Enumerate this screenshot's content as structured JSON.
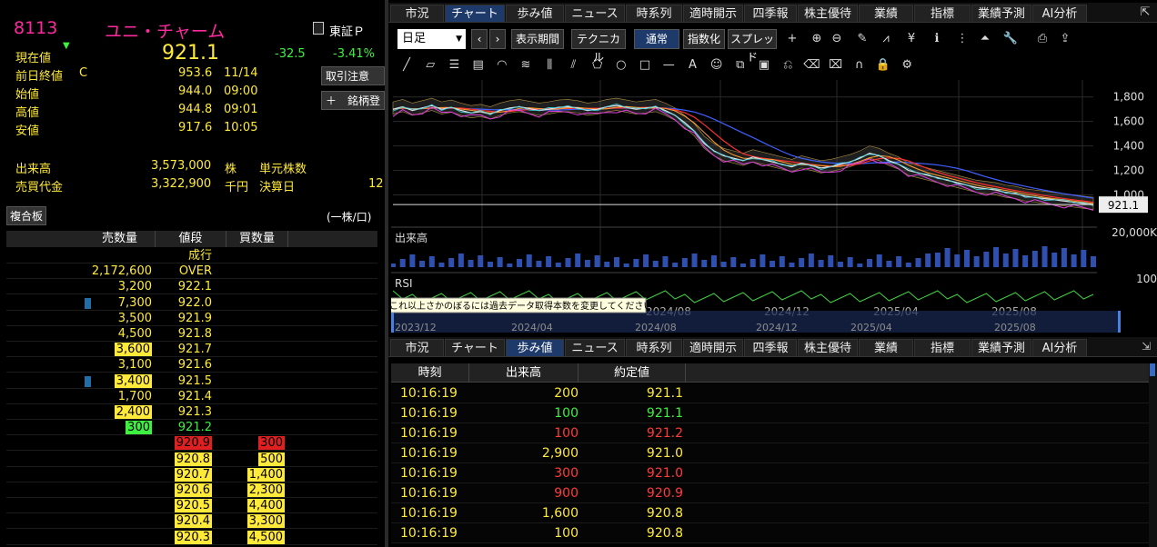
{
  "quote": {
    "code": "8113",
    "name": "ユニ・チャーム",
    "market": "東証Ｐ",
    "price_label": "現在値",
    "price": "921.1",
    "change": "-32.5",
    "change_pct": "-3.41%",
    "rows": [
      {
        "label": "前日終値",
        "flag": "C",
        "value": "953.6",
        "time": "11/14"
      },
      {
        "label": "始値",
        "flag": "",
        "value": "944.0",
        "time": "09:00"
      },
      {
        "label": "高値",
        "flag": "",
        "value": "944.8",
        "time": "09:01"
      },
      {
        "label": "安値",
        "flag": "",
        "value": "917.6",
        "time": "10:05"
      }
    ],
    "volume_label": "出来高",
    "volume": "3,573,000",
    "volume_unit": "株",
    "value_label": "売買代金",
    "value": "3,322,900",
    "value_unit": "千円",
    "unit_label": "単元株数",
    "settle_label": "決算日",
    "settle_value": "12"
  },
  "buttons": {
    "order_notice": "取引注意",
    "add_stock": "＋　銘柄登",
    "composite": "複合板",
    "per_unit": "(一株/口)"
  },
  "book": {
    "headers": [
      "売数量",
      "値段",
      "買数量"
    ],
    "rows": [
      {
        "sell": "",
        "price": "成行",
        "buy": "",
        "ph": "",
        "sh": "",
        "bh": "",
        "mk": false
      },
      {
        "sell": "2,172,600",
        "price": "OVER",
        "buy": "",
        "ph": "",
        "sh": "",
        "bh": "",
        "mk": false
      },
      {
        "sell": "3,200",
        "price": "922.1",
        "buy": "",
        "ph": "",
        "sh": "",
        "bh": "",
        "mk": false
      },
      {
        "sell": "7,300",
        "price": "922.0",
        "buy": "",
        "ph": "",
        "sh": "",
        "bh": "",
        "mk": true
      },
      {
        "sell": "3,500",
        "price": "921.9",
        "buy": "",
        "ph": "",
        "sh": "",
        "bh": "",
        "mk": false
      },
      {
        "sell": "4,500",
        "price": "921.8",
        "buy": "",
        "ph": "",
        "sh": "",
        "bh": "",
        "mk": false
      },
      {
        "sell": "3,600",
        "price": "921.7",
        "buy": "",
        "ph": "",
        "sh": "y",
        "bh": "",
        "mk": false
      },
      {
        "sell": "3,100",
        "price": "921.6",
        "buy": "",
        "ph": "",
        "sh": "",
        "bh": "",
        "mk": false
      },
      {
        "sell": "3,400",
        "price": "921.5",
        "buy": "",
        "ph": "",
        "sh": "y",
        "bh": "",
        "mk": true
      },
      {
        "sell": "1,700",
        "price": "921.4",
        "buy": "",
        "ph": "",
        "sh": "",
        "bh": "",
        "mk": false
      },
      {
        "sell": "2,400",
        "price": "921.3",
        "buy": "",
        "ph": "",
        "sh": "y",
        "bh": "",
        "mk": false
      },
      {
        "sell": "300",
        "price": "921.2",
        "buy": "",
        "ph": "",
        "sh": "g",
        "bh": "",
        "mk": false
      },
      {
        "sell": "",
        "price": "920.9",
        "buy": "300",
        "ph": "r",
        "sh": "",
        "bh": "r",
        "mk": false
      },
      {
        "sell": "",
        "price": "920.8",
        "buy": "500",
        "ph": "y",
        "sh": "",
        "bh": "y",
        "mk": false
      },
      {
        "sell": "",
        "price": "920.7",
        "buy": "1,400",
        "ph": "y",
        "sh": "",
        "bh": "y",
        "mk": false
      },
      {
        "sell": "",
        "price": "920.6",
        "buy": "2,300",
        "ph": "y",
        "sh": "",
        "bh": "y",
        "mk": false
      },
      {
        "sell": "",
        "price": "920.5",
        "buy": "4,400",
        "ph": "y",
        "sh": "",
        "bh": "y",
        "mk": false
      },
      {
        "sell": "",
        "price": "920.4",
        "buy": "3,300",
        "ph": "y",
        "sh": "",
        "bh": "y",
        "mk": false
      },
      {
        "sell": "",
        "price": "920.3",
        "buy": "4,500",
        "ph": "y",
        "sh": "",
        "bh": "y",
        "mk": false
      }
    ]
  },
  "tabs_top": [
    "市況",
    "チャート",
    "歩み値",
    "ニュース",
    "時系列",
    "適時開示",
    "四季報",
    "株主優待",
    "業績",
    "指標",
    "業績予測",
    "AI分析"
  ],
  "tabs_bottom": [
    "市況",
    "チャート",
    "歩み値",
    "ニュース",
    "時系列",
    "適時開示",
    "四季報",
    "株主優待",
    "業績",
    "指標",
    "業績予測",
    "AI分析"
  ],
  "toolbar": {
    "period": "日足",
    "show_period": "表示期間",
    "technical": "テクニカル",
    "normal": "通常",
    "index": "指数化",
    "spread": "スプレッド"
  },
  "chart": {
    "yticks": [
      "1,800",
      "1,600",
      "1,400",
      "1,200",
      "1,000"
    ],
    "last_price": "921.1",
    "vol_label": "出来高",
    "vol_tick": "20,000K",
    "rsi_label": "RSI",
    "rsi_tick": "100",
    "tooltip": "これ以上さかのぼるには過去データ取得本数を変更してください",
    "dates_top": [
      "2024/08",
      "2024/12",
      "2025/04",
      "2025/08"
    ],
    "dates_bottom": [
      "2023/12",
      "2024/04",
      "2024/08",
      "2024/12",
      "2025/04",
      "2025/08"
    ],
    "price_path": [
      1700,
      1720,
      1690,
      1710,
      1730,
      1700,
      1715,
      1690,
      1670,
      1680,
      1660,
      1690,
      1710,
      1720,
      1705,
      1690,
      1700,
      1715,
      1720,
      1710,
      1690,
      1700,
      1720,
      1730,
      1715,
      1700,
      1710,
      1720,
      1690,
      1650,
      1590,
      1520,
      1420,
      1360,
      1320,
      1300,
      1280,
      1310,
      1290,
      1270,
      1250,
      1230,
      1260,
      1240,
      1220,
      1230,
      1250,
      1270,
      1300,
      1340,
      1320,
      1280,
      1250,
      1200,
      1180,
      1160,
      1140,
      1120,
      1100,
      1080,
      1060,
      1050,
      1040,
      1020,
      1010,
      990,
      980,
      970,
      960,
      950,
      940,
      930,
      921
    ]
  },
  "timesales": {
    "headers": [
      "時刻",
      "出来高",
      "約定値"
    ],
    "rows": [
      {
        "time": "10:16:19",
        "vol": "200",
        "price": "921.1",
        "vc": "y",
        "pc": "y"
      },
      {
        "time": "10:16:19",
        "vol": "100",
        "price": "921.1",
        "vc": "g",
        "pc": "g"
      },
      {
        "time": "10:16:19",
        "vol": "100",
        "price": "921.2",
        "vc": "r",
        "pc": "r"
      },
      {
        "time": "10:16:19",
        "vol": "2,900",
        "price": "921.0",
        "vc": "y",
        "pc": "y"
      },
      {
        "time": "10:16:19",
        "vol": "300",
        "price": "921.0",
        "vc": "r",
        "pc": "r"
      },
      {
        "time": "10:16:19",
        "vol": "900",
        "price": "920.9",
        "vc": "r",
        "pc": "r"
      },
      {
        "time": "10:16:19",
        "vol": "1,600",
        "price": "920.8",
        "vc": "y",
        "pc": "y"
      },
      {
        "time": "10:16:19",
        "vol": "100",
        "price": "920.8",
        "vc": "y",
        "pc": "y"
      }
    ]
  },
  "colors": {
    "up": "#ff3b3b",
    "down": "#3ef040",
    "accent": "#ffea3a",
    "tab_active": "#1d3a6b"
  }
}
